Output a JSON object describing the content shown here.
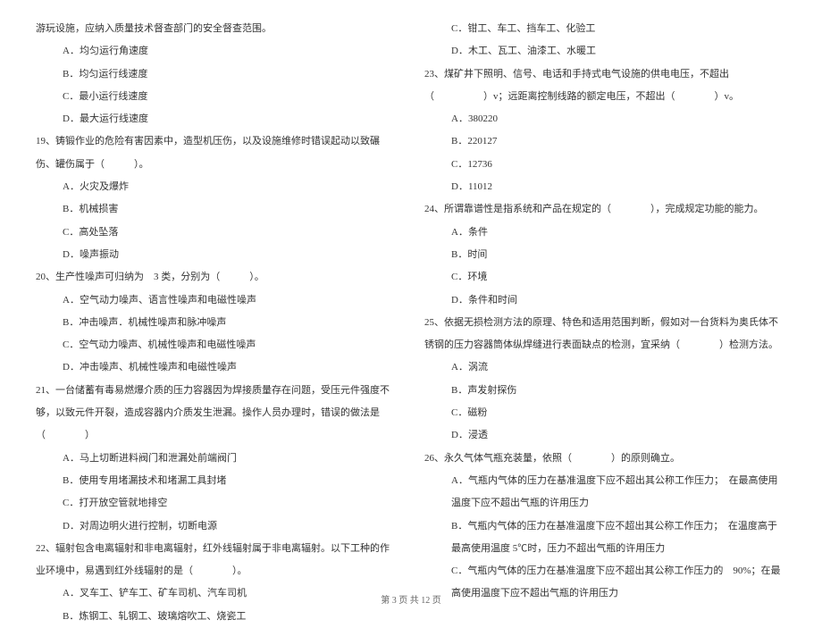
{
  "left": {
    "intro": "游玩设施，应纳入质量技术督查部门的安全督查范围。",
    "q18_opts": [
      "A．均匀运行角速度",
      "B．均匀运行线速度",
      "C．最小运行线速度",
      "D．最大运行线速度"
    ],
    "q19": "19、铸锻作业的危险有害因素中，造型机压伤，以及设施维修时错误起动以致碾伤、罐伤属于（　　　）。",
    "q19_opts": [
      "A．火灾及爆炸",
      "B．机械损害",
      "C．高处坠落",
      "D．噪声振动"
    ],
    "q20": "20、生产性噪声可归纳为　3 类，分别为（　　　）。",
    "q20_opts": [
      "A．空气动力噪声、语言性噪声和电磁性噪声",
      "B．冲击噪声．机械性噪声和脉冲噪声",
      "C．空气动力噪声、机械性噪声和电磁性噪声",
      "D．冲击噪声、机械性噪声和电磁性噪声"
    ],
    "q21": "21、一台储蓄有毒易燃爆介质的压力容器因为焊接质量存在问题，受压元件强度不够，以致元件开裂，造成容器内介质发生泄漏。操作人员办理时，错误的做法是（　　　　）",
    "q21_opts": [
      "A．马上切断进料阀门和泄漏处前端阀门",
      "B．使用专用堵漏技术和堵漏工具封堵",
      "C．打开放空管就地排空",
      "D．对周边明火进行控制，切断电源"
    ],
    "q22": "22、辐射包含电离辐射和非电离辐射，红外线辐射属于非电离辐射。以下工种的作业环境中，易遇到红外线辐射的是（　　　　）。",
    "q22_opts": [
      "A．叉车工、铲车工、矿车司机、汽车司机",
      "B．炼钢工、轧钢工、玻璃熔吹工、烧瓷工"
    ]
  },
  "right": {
    "q22_opts_cont": [
      "C．钳工、车工、挡车工、化验工",
      "D．木工、瓦工、油漆工、水暖工"
    ],
    "q23": "23、煤矿井下照明、信号、电话和手持式电气设施的供电电压，不超出（　　　　　）v；远距离控制线路的额定电压，不超出（　　　　）v。",
    "q23_opts": [
      "A．380220",
      "B．220127",
      "C．12736",
      "D．11012"
    ],
    "q24": "24、所谓靠谱性是指系统和产品在规定的（　　　　），完成规定功能的能力。",
    "q24_opts": [
      "A．条件",
      "B．时间",
      "C．环境",
      "D．条件和时间"
    ],
    "q25": "25、依据无损检测方法的原理、特色和适用范围判断，假如对一台货料为奥氏体不锈钢的压力容器筒体纵焊缝进行表面缺点的检测，宜采纳（　　　　）检测方法。",
    "q25_opts": [
      "A．涡流",
      "B．声发射探伤",
      "C．磁粉",
      "D．浸透"
    ],
    "q26": "26、永久气体气瓶充装量，依照（　　　　）的原则确立。",
    "q26_opts": [
      "A．气瓶内气体的压力在基准温度下应不超出其公称工作压力；　在最高使用温度下应不超出气瓶的许用压力",
      "B．气瓶内气体的压力在基准温度下应不超出其公称工作压力；　在温度高于最高使用温度 5℃时，压力不超出气瓶的许用压力",
      "C．气瓶内气体的压力在基准温度下应不超出其公称工作压力的　90%；在最高使用温度下应不超出气瓶的许用压力"
    ]
  },
  "footer": "第 3 页 共 12 页"
}
